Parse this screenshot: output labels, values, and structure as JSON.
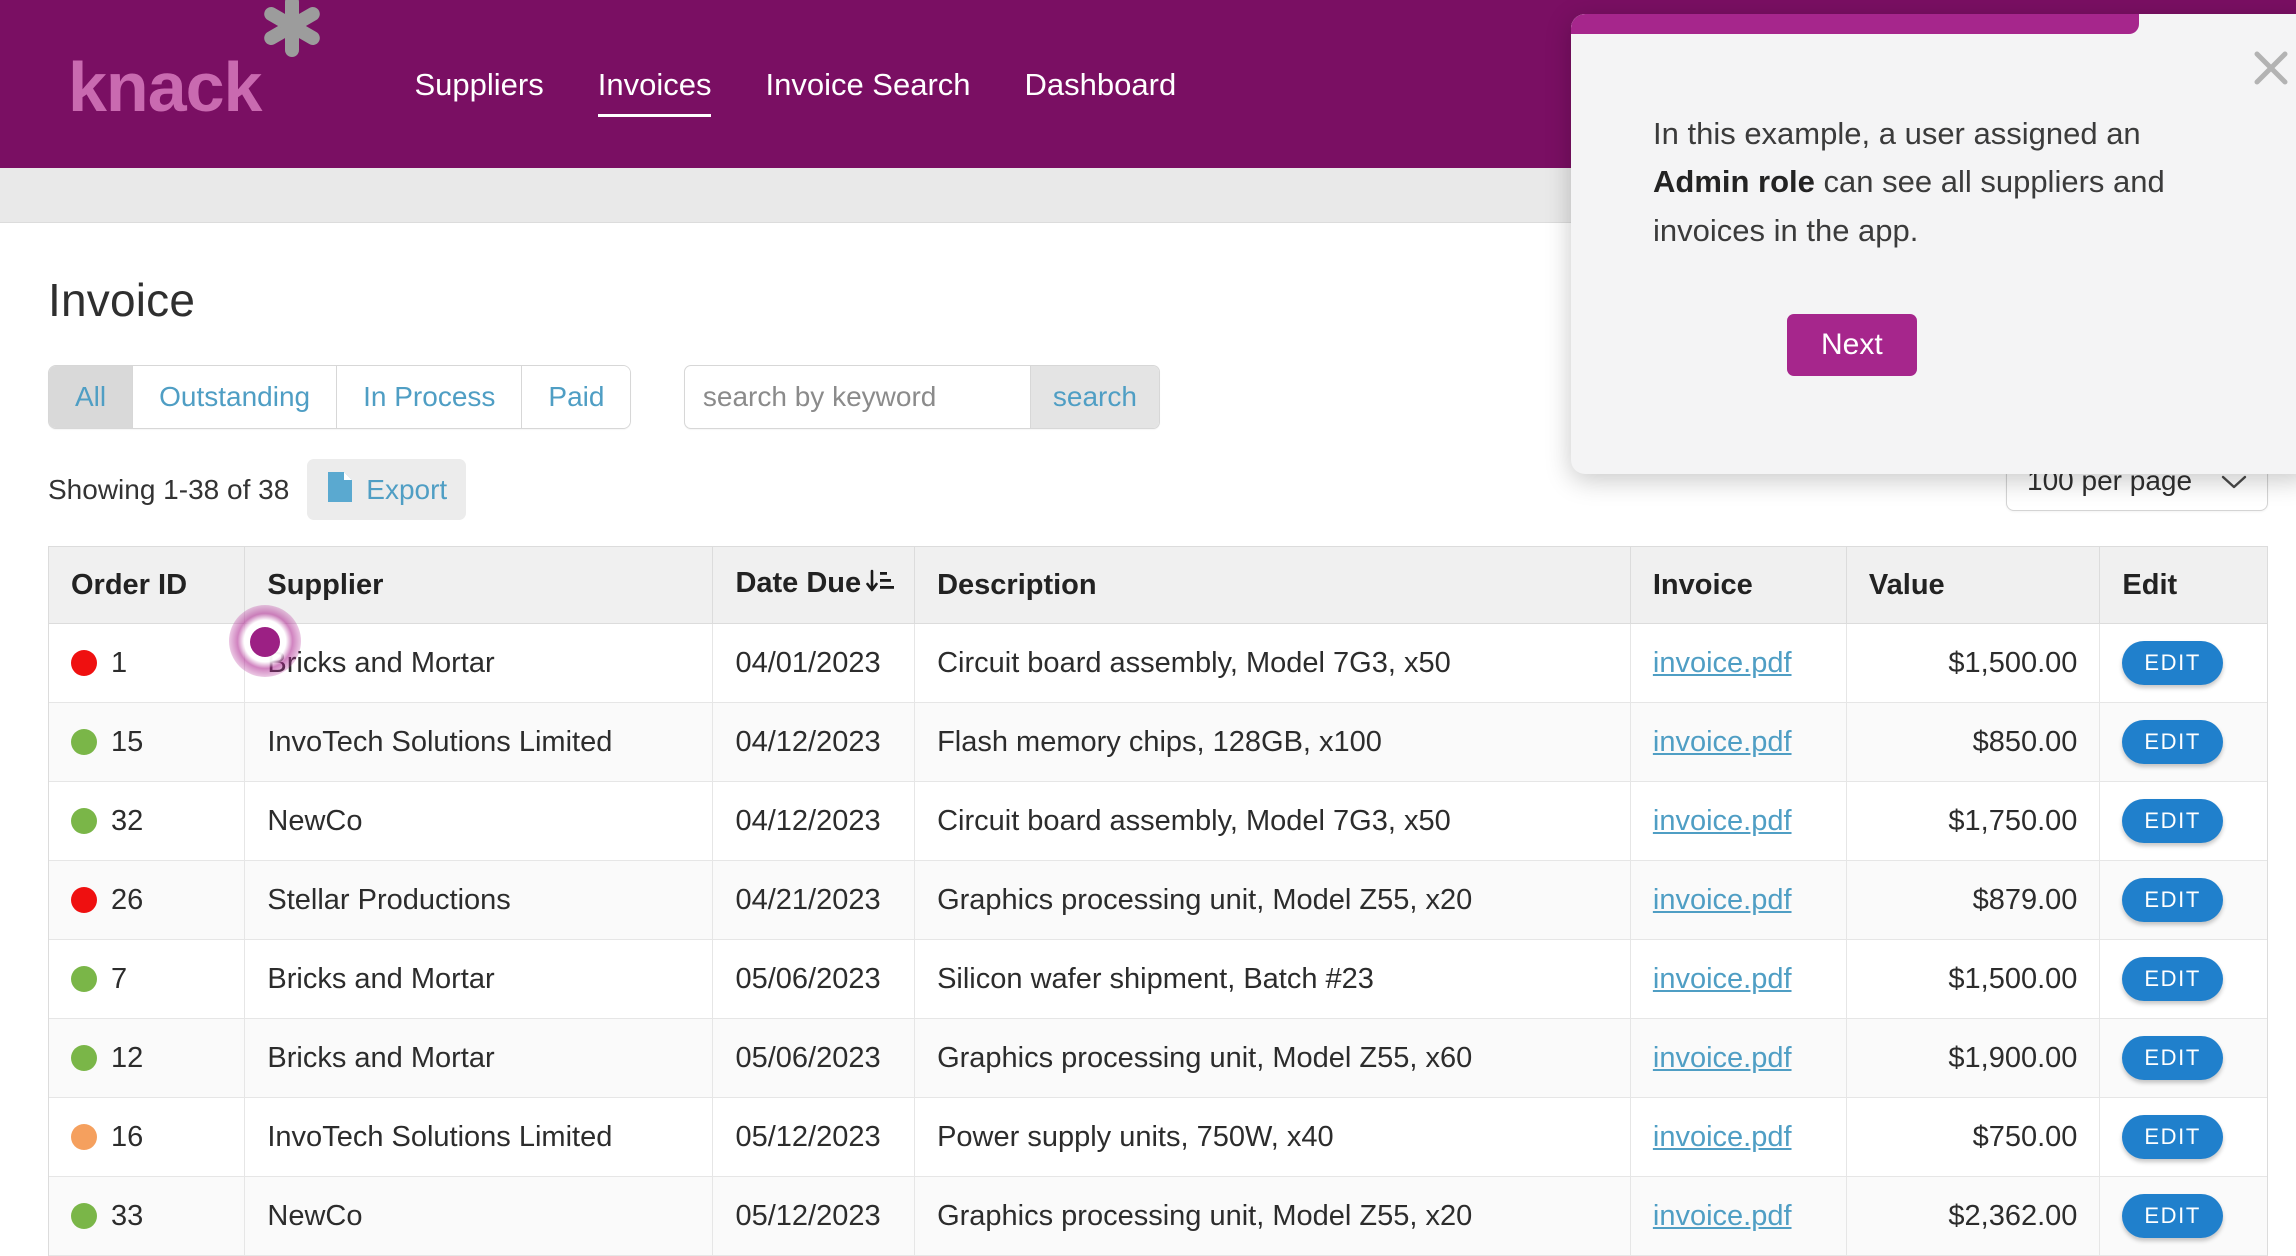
{
  "nav": {
    "logo_text": "knack",
    "logo_icon": "asterisk-icon",
    "links": [
      {
        "label": "Suppliers",
        "active": false
      },
      {
        "label": "Invoices",
        "active": true
      },
      {
        "label": "Invoice Search",
        "active": false
      },
      {
        "label": "Dashboard",
        "active": false
      }
    ]
  },
  "page": {
    "title": "Invoice"
  },
  "filter_tabs": [
    {
      "label": "All",
      "active": true
    },
    {
      "label": "Outstanding",
      "active": false
    },
    {
      "label": "In Process",
      "active": false
    },
    {
      "label": "Paid",
      "active": false
    }
  ],
  "search": {
    "placeholder": "search by keyword",
    "value": "",
    "button_label": "search"
  },
  "toolbar": {
    "showing_text": "Showing 1-38 of 38",
    "export_label": "Export",
    "export_icon": "document-icon",
    "per_page_label": "100 per page",
    "per_page_icon": "chevron-down-icon"
  },
  "table": {
    "columns": [
      {
        "key": "order_id",
        "label": "Order ID",
        "align": "left"
      },
      {
        "key": "supplier",
        "label": "Supplier",
        "align": "left"
      },
      {
        "key": "date_due",
        "label": "Date Due",
        "align": "left",
        "sort_icon": "sort-ascending-icon"
      },
      {
        "key": "description",
        "label": "Description",
        "align": "left"
      },
      {
        "key": "invoice",
        "label": "Invoice",
        "align": "left"
      },
      {
        "key": "value",
        "label": "Value",
        "align": "right"
      },
      {
        "key": "edit",
        "label": "Edit",
        "align": "left"
      }
    ],
    "edit_button_label": "EDIT",
    "rows": [
      {
        "status_color": "#ef1010",
        "order_id": "1",
        "supplier": "Bricks and Mortar",
        "date_due": "04/01/2023",
        "description": "Circuit board assembly, Model 7G3, x50",
        "invoice": "invoice.pdf",
        "value": "$1,500.00"
      },
      {
        "status_color": "#7ab648",
        "order_id": "15",
        "supplier": "InvoTech Solutions Limited",
        "date_due": "04/12/2023",
        "description": "Flash memory chips, 128GB, x100",
        "invoice": "invoice.pdf",
        "value": "$850.00"
      },
      {
        "status_color": "#7ab648",
        "order_id": "32",
        "supplier": "NewCo",
        "date_due": "04/12/2023",
        "description": "Circuit board assembly, Model 7G3, x50",
        "invoice": "invoice.pdf",
        "value": "$1,750.00"
      },
      {
        "status_color": "#ef1010",
        "order_id": "26",
        "supplier": "Stellar Productions",
        "date_due": "04/21/2023",
        "description": "Graphics processing unit, Model Z55, x20",
        "invoice": "invoice.pdf",
        "value": "$879.00"
      },
      {
        "status_color": "#7ab648",
        "order_id": "7",
        "supplier": "Bricks and Mortar",
        "date_due": "05/06/2023",
        "description": "Silicon wafer shipment, Batch #23",
        "invoice": "invoice.pdf",
        "value": "$1,500.00"
      },
      {
        "status_color": "#7ab648",
        "order_id": "12",
        "supplier": "Bricks and Mortar",
        "date_due": "05/06/2023",
        "description": "Graphics processing unit, Model Z55, x60",
        "invoice": "invoice.pdf",
        "value": "$1,900.00"
      },
      {
        "status_color": "#f5a05e",
        "order_id": "16",
        "supplier": "InvoTech Solutions Limited",
        "date_due": "05/12/2023",
        "description": "Power supply units, 750W, x40",
        "invoice": "invoice.pdf",
        "value": "$750.00"
      },
      {
        "status_color": "#7ab648",
        "order_id": "33",
        "supplier": "NewCo",
        "date_due": "05/12/2023",
        "description": "Graphics processing unit, Model Z55, x20",
        "invoice": "invoice.pdf",
        "value": "$2,362.00"
      }
    ]
  },
  "tour_popup": {
    "text_part1": "In this example, a user assigned an ",
    "text_bold": "Admin role",
    "text_part2": " can see all suppliers and invoices in the app.",
    "next_label": "Next",
    "close_icon": "close-icon"
  },
  "colors": {
    "brand_purple": "#7a0f63",
    "accent_magenta": "#a6268c",
    "link_blue": "#4f9ec4",
    "edit_blue": "#2080cc",
    "status_red": "#ef1010",
    "status_green": "#7ab648",
    "status_orange": "#f5a05e"
  }
}
